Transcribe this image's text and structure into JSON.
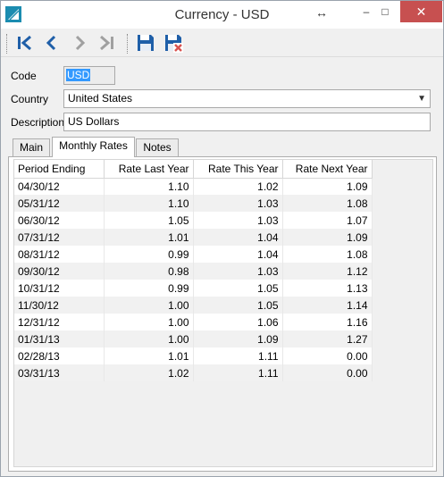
{
  "window": {
    "title": "Currency - USD",
    "close_symbol": "✕",
    "minimize_symbol": "–",
    "maximize_symbol": "□",
    "resize_symbol": "↔"
  },
  "toolbar": {
    "buttons": [
      {
        "name": "first-record",
        "icon": "first-icon"
      },
      {
        "name": "previous-record",
        "icon": "previous-icon"
      },
      {
        "name": "next-record",
        "icon": "next-icon"
      },
      {
        "name": "last-record",
        "icon": "last-icon"
      },
      {
        "name": "save",
        "icon": "save-icon"
      },
      {
        "name": "delete",
        "icon": "delete-icon"
      }
    ]
  },
  "form": {
    "code_label": "Code",
    "code_value": "USD",
    "country_label": "Country",
    "country_value": "United States",
    "description_label": "Description",
    "description_value": "US Dollars"
  },
  "tabs": [
    {
      "label": "Main",
      "active": false
    },
    {
      "label": "Monthly Rates",
      "active": true
    },
    {
      "label": "Notes",
      "active": false
    }
  ],
  "grid": {
    "columns": [
      "Period Ending",
      "Rate Last Year",
      "Rate This Year",
      "Rate Next Year"
    ],
    "rows": [
      [
        "04/30/12",
        "1.10",
        "1.02",
        "1.09"
      ],
      [
        "05/31/12",
        "1.10",
        "1.03",
        "1.08"
      ],
      [
        "06/30/12",
        "1.05",
        "1.03",
        "1.07"
      ],
      [
        "07/31/12",
        "1.01",
        "1.04",
        "1.09"
      ],
      [
        "08/31/12",
        "0.99",
        "1.04",
        "1.08"
      ],
      [
        "09/30/12",
        "0.98",
        "1.03",
        "1.12"
      ],
      [
        "10/31/12",
        "0.99",
        "1.05",
        "1.13"
      ],
      [
        "11/30/12",
        "1.00",
        "1.05",
        "1.14"
      ],
      [
        "12/31/12",
        "1.00",
        "1.06",
        "1.16"
      ],
      [
        "01/31/13",
        "1.00",
        "1.09",
        "1.27"
      ],
      [
        "02/28/13",
        "1.01",
        "1.11",
        "0.00"
      ],
      [
        "03/31/13",
        "1.02",
        "1.11",
        "0.00"
      ]
    ]
  },
  "colors": {
    "accent": "#1f5fa8",
    "close_button": "#c75050",
    "selection": "#3399ff"
  }
}
